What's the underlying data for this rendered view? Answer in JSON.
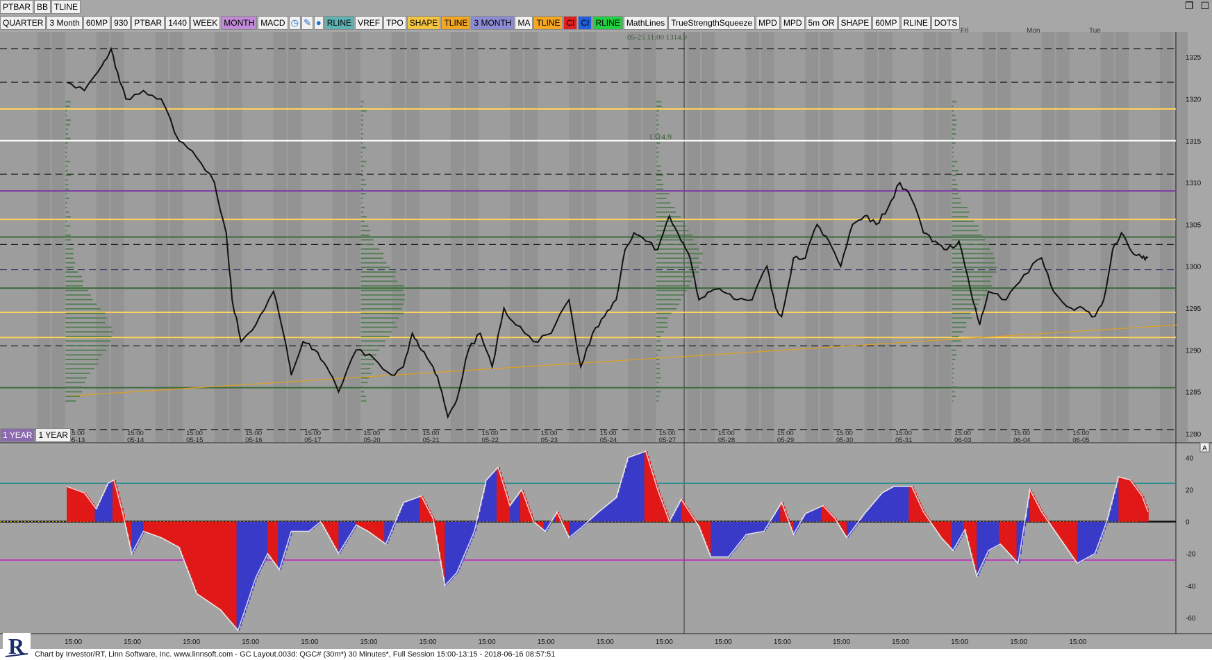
{
  "toolbar_row1": [
    "PTBAR",
    "BB",
    "TLINE"
  ],
  "toolbar": [
    {
      "label": "QUARTER",
      "bg": "#f0f0f0"
    },
    {
      "label": "3 Month",
      "bg": "#f0f0f0"
    },
    {
      "label": "60MP",
      "bg": "#f0f0f0"
    },
    {
      "label": "930",
      "bg": "#f0f0f0"
    },
    {
      "label": "PTBAR",
      "bg": "#f0f0f0"
    },
    {
      "label": "1440",
      "bg": "#f0f0f0"
    },
    {
      "label": "WEEK",
      "bg": "#f0f0f0"
    },
    {
      "label": "MONTH",
      "bg": "#c08ad6"
    },
    {
      "label": "MACD",
      "bg": "#f0f0f0"
    },
    {
      "label": "",
      "icon": "clock-icon",
      "glyph": "◷",
      "bg": "#f0f0f0"
    },
    {
      "label": "",
      "icon": "pencil-icon",
      "glyph": "✎",
      "bg": "#f0f0f0"
    },
    {
      "label": "",
      "icon": "drop-icon",
      "glyph": "●",
      "bg": "#f0f0f0"
    },
    {
      "label": "RLINE",
      "bg": "#5fb3b3"
    },
    {
      "label": "VREF",
      "bg": "#f0f0f0"
    },
    {
      "label": "TPO",
      "bg": "#f0f0f0"
    },
    {
      "label": "SHAPE",
      "bg": "#f5c542"
    },
    {
      "label": "TLINE",
      "bg": "#f5a623"
    },
    {
      "label": "3 MONTH",
      "bg": "#8c8cd6"
    },
    {
      "label": "MA",
      "bg": "#f0f0f0"
    },
    {
      "label": "TLINE",
      "bg": "#f5a623"
    },
    {
      "label": "CI",
      "bg": "#e02020"
    },
    {
      "label": "CI",
      "bg": "#2060e0"
    },
    {
      "label": "RLINE",
      "bg": "#20d040"
    },
    {
      "label": "MathLines",
      "bg": "#f0f0f0"
    },
    {
      "label": "TrueStrengthSqueeze",
      "bg": "#f0f0f0"
    },
    {
      "label": "MPD",
      "bg": "#f0f0f0"
    },
    {
      "label": "MPD",
      "bg": "#f0f0f0"
    },
    {
      "label": "5m OR",
      "bg": "#f0f0f0"
    },
    {
      "label": "SHAPE",
      "bg": "#f0f0f0"
    },
    {
      "label": "60MP",
      "bg": "#f0f0f0"
    },
    {
      "label": "RLINE",
      "bg": "#f0f0f0"
    },
    {
      "label": "DOTS",
      "bg": "#f0f0f0"
    }
  ],
  "year_buttons": [
    "1 YEAR",
    "1 YEAR"
  ],
  "footer": "Chart by Investor/RT, Linn Software, Inc. www.linnsoft.com - GC Layout.003d: QGC# (30m*) 30 Minutes*, Full Session 15:00-13:15 - 2018-06-16 08:57:51",
  "day_names": [
    "Fri",
    "Mon",
    "Tue"
  ],
  "annotations": {
    "crosshair_label": "05-25 11:00  1314.9",
    "price_label": "1314.9"
  },
  "chart_data": [
    {
      "type": "line",
      "title": "",
      "y_axis_ticks": [
        1280,
        1285,
        1290,
        1295,
        1300,
        1305,
        1310,
        1315,
        1320,
        1325
      ],
      "ylim": [
        1279,
        1328
      ],
      "x_labels": [
        {
          "time": "15:00",
          "date": "05-13"
        },
        {
          "time": "15:00",
          "date": "05-14"
        },
        {
          "time": "15:00",
          "date": "05-15"
        },
        {
          "time": "15:00",
          "date": "05-16"
        },
        {
          "time": "15:00",
          "date": "05-17"
        },
        {
          "time": "15:00",
          "date": "05-20"
        },
        {
          "time": "15:00",
          "date": "05-21"
        },
        {
          "time": "15:00",
          "date": "05-22"
        },
        {
          "time": "15:00",
          "date": "05-23"
        },
        {
          "time": "15:00",
          "date": "05-24"
        },
        {
          "time": "15:00",
          "date": "05-27"
        },
        {
          "time": "15:00",
          "date": "05-28"
        },
        {
          "time": "15:00",
          "date": "05-29"
        },
        {
          "time": "15:00",
          "date": "05-30"
        },
        {
          "time": "15:00",
          "date": "05-31"
        },
        {
          "time": "15:00",
          "date": "06-03"
        },
        {
          "time": "15:00",
          "date": "06-04"
        },
        {
          "time": "15:00",
          "date": "06-05"
        }
      ],
      "price_path": [
        [
          0,
          1322
        ],
        [
          0.3,
          1321
        ],
        [
          0.6,
          1324
        ],
        [
          0.75,
          1326
        ],
        [
          0.9,
          1322
        ],
        [
          1.0,
          1320
        ],
        [
          1.3,
          1321
        ],
        [
          1.6,
          1320
        ],
        [
          1.9,
          1315
        ],
        [
          2.2,
          1313
        ],
        [
          2.5,
          1310
        ],
        [
          2.7,
          1304
        ],
        [
          2.8,
          1296
        ],
        [
          2.95,
          1291
        ],
        [
          3.2,
          1293
        ],
        [
          3.5,
          1297
        ],
        [
          3.7,
          1291
        ],
        [
          3.8,
          1287
        ],
        [
          4.0,
          1291
        ],
        [
          4.2,
          1290
        ],
        [
          4.4,
          1288
        ],
        [
          4.6,
          1285
        ],
        [
          4.9,
          1290
        ],
        [
          5.2,
          1289
        ],
        [
          5.5,
          1287
        ],
        [
          5.7,
          1288
        ],
        [
          5.85,
          1292
        ],
        [
          6.0,
          1290
        ],
        [
          6.2,
          1288
        ],
        [
          6.35,
          1285
        ],
        [
          6.45,
          1282
        ],
        [
          6.6,
          1284
        ],
        [
          6.8,
          1290
        ],
        [
          7.0,
          1292
        ],
        [
          7.2,
          1288
        ],
        [
          7.4,
          1295
        ],
        [
          7.6,
          1293
        ],
        [
          7.9,
          1291
        ],
        [
          8.2,
          1292
        ],
        [
          8.5,
          1296
        ],
        [
          8.7,
          1288
        ],
        [
          8.9,
          1292
        ],
        [
          9.1,
          1294
        ],
        [
          9.3,
          1296
        ],
        [
          9.45,
          1302
        ],
        [
          9.6,
          1304
        ],
        [
          9.8,
          1303
        ],
        [
          10.0,
          1302
        ],
        [
          10.2,
          1306
        ],
        [
          10.4,
          1303
        ],
        [
          10.55,
          1301
        ],
        [
          10.7,
          1296
        ],
        [
          10.9,
          1297
        ],
        [
          11.1,
          1297
        ],
        [
          11.35,
          1296
        ],
        [
          11.6,
          1296
        ],
        [
          11.85,
          1300
        ],
        [
          12.0,
          1295
        ],
        [
          12.1,
          1294
        ],
        [
          12.3,
          1301
        ],
        [
          12.5,
          1301
        ],
        [
          12.7,
          1305
        ],
        [
          12.9,
          1303
        ],
        [
          13.1,
          1300
        ],
        [
          13.3,
          1305
        ],
        [
          13.5,
          1306
        ],
        [
          13.7,
          1305
        ],
        [
          13.9,
          1307
        ],
        [
          14.1,
          1310
        ],
        [
          14.3,
          1308
        ],
        [
          14.5,
          1304
        ],
        [
          14.7,
          1303
        ],
        [
          14.9,
          1302
        ],
        [
          15.1,
          1303
        ],
        [
          15.3,
          1297
        ],
        [
          15.45,
          1293
        ],
        [
          15.6,
          1297
        ],
        [
          15.9,
          1296
        ],
        [
          16.2,
          1299
        ],
        [
          16.5,
          1301
        ],
        [
          16.7,
          1297
        ],
        [
          17.0,
          1295
        ],
        [
          17.2,
          1295
        ],
        [
          17.4,
          1294
        ],
        [
          17.55,
          1296
        ],
        [
          17.7,
          1302
        ],
        [
          17.85,
          1304
        ],
        [
          18.0,
          1302
        ],
        [
          18.2,
          1301
        ],
        [
          18.3,
          1301
        ]
      ],
      "horizontal_levels": [
        {
          "value": 1326,
          "color": "#111111",
          "style": "dashed"
        },
        {
          "value": 1322,
          "color": "#111111",
          "style": "dashed"
        },
        {
          "value": 1318.8,
          "color": "#ffd25a",
          "style": "solid"
        },
        {
          "value": 1315,
          "color": "#ffffff",
          "style": "solid"
        },
        {
          "value": 1309,
          "color": "#7d3aa8",
          "style": "solid"
        },
        {
          "value": 1311,
          "color": "#111111",
          "style": "dashed"
        },
        {
          "value": 1305.6,
          "color": "#ffd25a",
          "style": "solid"
        },
        {
          "value": 1303.5,
          "color": "#3b6b3b",
          "style": "solid"
        },
        {
          "value": 1302.6,
          "color": "#111111",
          "style": "dashed"
        },
        {
          "value": 1299.6,
          "color": "#333366",
          "style": "dashed"
        },
        {
          "value": 1297.4,
          "color": "#3b6b3b",
          "style": "solid"
        },
        {
          "value": 1294.5,
          "color": "#ffd25a",
          "style": "solid"
        },
        {
          "value": 1291.5,
          "color": "#ffd25a",
          "style": "solid"
        },
        {
          "value": 1290.5,
          "color": "#111111",
          "style": "dashed"
        },
        {
          "value": 1285.5,
          "color": "#3b6b3b",
          "style": "solid"
        },
        {
          "value": 1280.5,
          "color": "#111111",
          "style": "dashed"
        }
      ],
      "trendline": {
        "from": [
          0,
          1284.5
        ],
        "to": [
          18.8,
          1293
        ],
        "color": "#e0a020"
      }
    },
    {
      "type": "area",
      "title": "",
      "y_axis_ticks": [
        40,
        20,
        0,
        -20,
        -40,
        -60
      ],
      "ylim": [
        -70,
        48
      ],
      "reference_lines": [
        {
          "value": 24,
          "color": "#1a8a8a"
        },
        {
          "value": 0,
          "color": "#111111"
        },
        {
          "value": -24,
          "color": "#c020c0"
        }
      ],
      "x_labels": [
        "15:00",
        "15:00",
        "15:00",
        "15:00",
        "15:00",
        "15:00",
        "15:00",
        "15:00",
        "15:00",
        "15:00",
        "15:00",
        "15:00",
        "15:00",
        "15:00",
        "15:00",
        "15:00",
        "15:00",
        "15:00"
      ],
      "macd_path": [
        [
          0,
          22
        ],
        [
          0.3,
          18
        ],
        [
          0.5,
          8
        ],
        [
          0.7,
          24
        ],
        [
          0.8,
          26
        ],
        [
          0.95,
          5
        ],
        [
          1.1,
          -20
        ],
        [
          1.3,
          -6
        ],
        [
          1.6,
          -10
        ],
        [
          1.9,
          -16
        ],
        [
          2.2,
          -45
        ],
        [
          2.6,
          -55
        ],
        [
          2.9,
          -68
        ],
        [
          3.2,
          -35
        ],
        [
          3.4,
          -20
        ],
        [
          3.6,
          -30
        ],
        [
          3.8,
          -6
        ],
        [
          4.1,
          -6
        ],
        [
          4.3,
          0
        ],
        [
          4.6,
          -20
        ],
        [
          4.9,
          -2
        ],
        [
          5.1,
          -6
        ],
        [
          5.4,
          -14
        ],
        [
          5.7,
          12
        ],
        [
          6.0,
          16
        ],
        [
          6.2,
          2
        ],
        [
          6.4,
          -40
        ],
        [
          6.6,
          -32
        ],
        [
          6.9,
          -6
        ],
        [
          7.1,
          26
        ],
        [
          7.3,
          34
        ],
        [
          7.5,
          10
        ],
        [
          7.7,
          20
        ],
        [
          7.9,
          0
        ],
        [
          8.1,
          -6
        ],
        [
          8.3,
          6
        ],
        [
          8.5,
          -10
        ],
        [
          8.7,
          -4
        ],
        [
          9.0,
          6
        ],
        [
          9.3,
          15
        ],
        [
          9.5,
          40
        ],
        [
          9.8,
          44
        ],
        [
          10.0,
          20
        ],
        [
          10.2,
          0
        ],
        [
          10.4,
          14
        ],
        [
          10.7,
          -3
        ],
        [
          10.9,
          -22
        ],
        [
          11.2,
          -22
        ],
        [
          11.5,
          -8
        ],
        [
          11.8,
          -6
        ],
        [
          12.1,
          12
        ],
        [
          12.3,
          -8
        ],
        [
          12.5,
          5
        ],
        [
          12.8,
          10
        ],
        [
          13.0,
          2
        ],
        [
          13.2,
          -10
        ],
        [
          13.5,
          5
        ],
        [
          13.8,
          18
        ],
        [
          14.0,
          22
        ],
        [
          14.3,
          22
        ],
        [
          14.5,
          6
        ],
        [
          14.8,
          -10
        ],
        [
          15.0,
          -18
        ],
        [
          15.2,
          -5
        ],
        [
          15.4,
          -34
        ],
        [
          15.6,
          -18
        ],
        [
          15.8,
          -14
        ],
        [
          16.1,
          -26
        ],
        [
          16.3,
          20
        ],
        [
          16.5,
          6
        ],
        [
          16.8,
          -10
        ],
        [
          17.1,
          -26
        ],
        [
          17.4,
          -20
        ],
        [
          17.6,
          0
        ],
        [
          17.8,
          28
        ],
        [
          18.0,
          26
        ],
        [
          18.2,
          16
        ],
        [
          18.3,
          6
        ]
      ]
    }
  ]
}
